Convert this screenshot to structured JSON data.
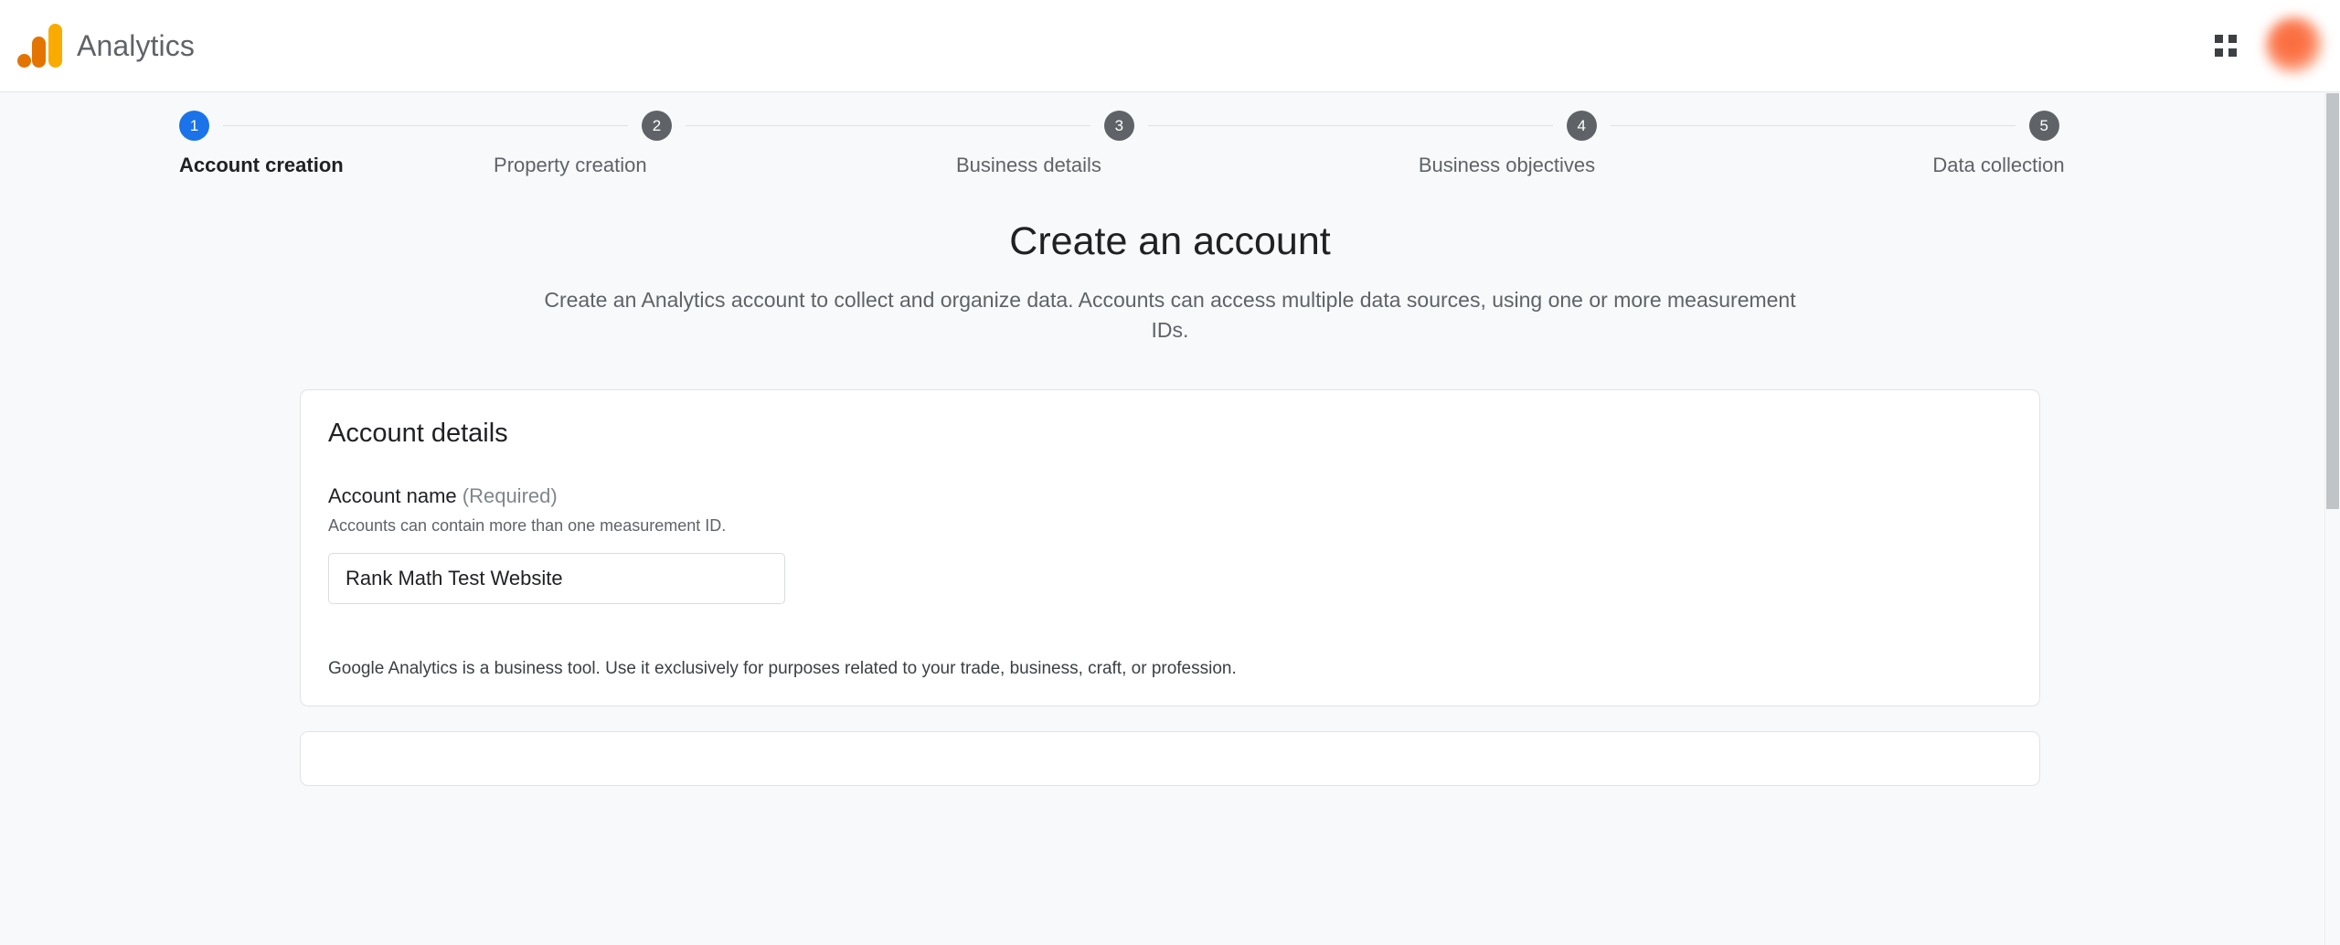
{
  "header": {
    "brand_title": "Analytics",
    "logo_icon": "google-analytics-logo",
    "apps_icon": "apps-grid-icon",
    "avatar_icon": "user-avatar"
  },
  "stepper": {
    "steps": [
      {
        "number": "1",
        "label": "Account creation",
        "state": "active"
      },
      {
        "number": "2",
        "label": "Property creation",
        "state": "inactive"
      },
      {
        "number": "3",
        "label": "Business details",
        "state": "inactive"
      },
      {
        "number": "4",
        "label": "Business objectives",
        "state": "inactive"
      },
      {
        "number": "5",
        "label": "Data collection",
        "state": "inactive"
      }
    ]
  },
  "main": {
    "title": "Create an account",
    "description": "Create an Analytics account to collect and organize data. Accounts can access multiple data sources, using one or more measurement IDs.",
    "card": {
      "title": "Account details",
      "field_label": "Account name",
      "field_optional": "(Required)",
      "field_help": "Accounts can contain more than one measurement ID.",
      "input_value": "Rank Math Test Website",
      "input_placeholder": "",
      "note": "Google Analytics is a business tool. Use it exclusively for purposes related to your trade, business, craft, or profession."
    }
  },
  "colors": {
    "accent_blue": "#1a73e8",
    "step_gray": "#5f6368",
    "logo_amber": "#f9ab00",
    "logo_orange": "#e37400",
    "page_bg": "#f7f9fa"
  },
  "scrollbar": {
    "thumb": "vertical-scrollbar-thumb"
  }
}
